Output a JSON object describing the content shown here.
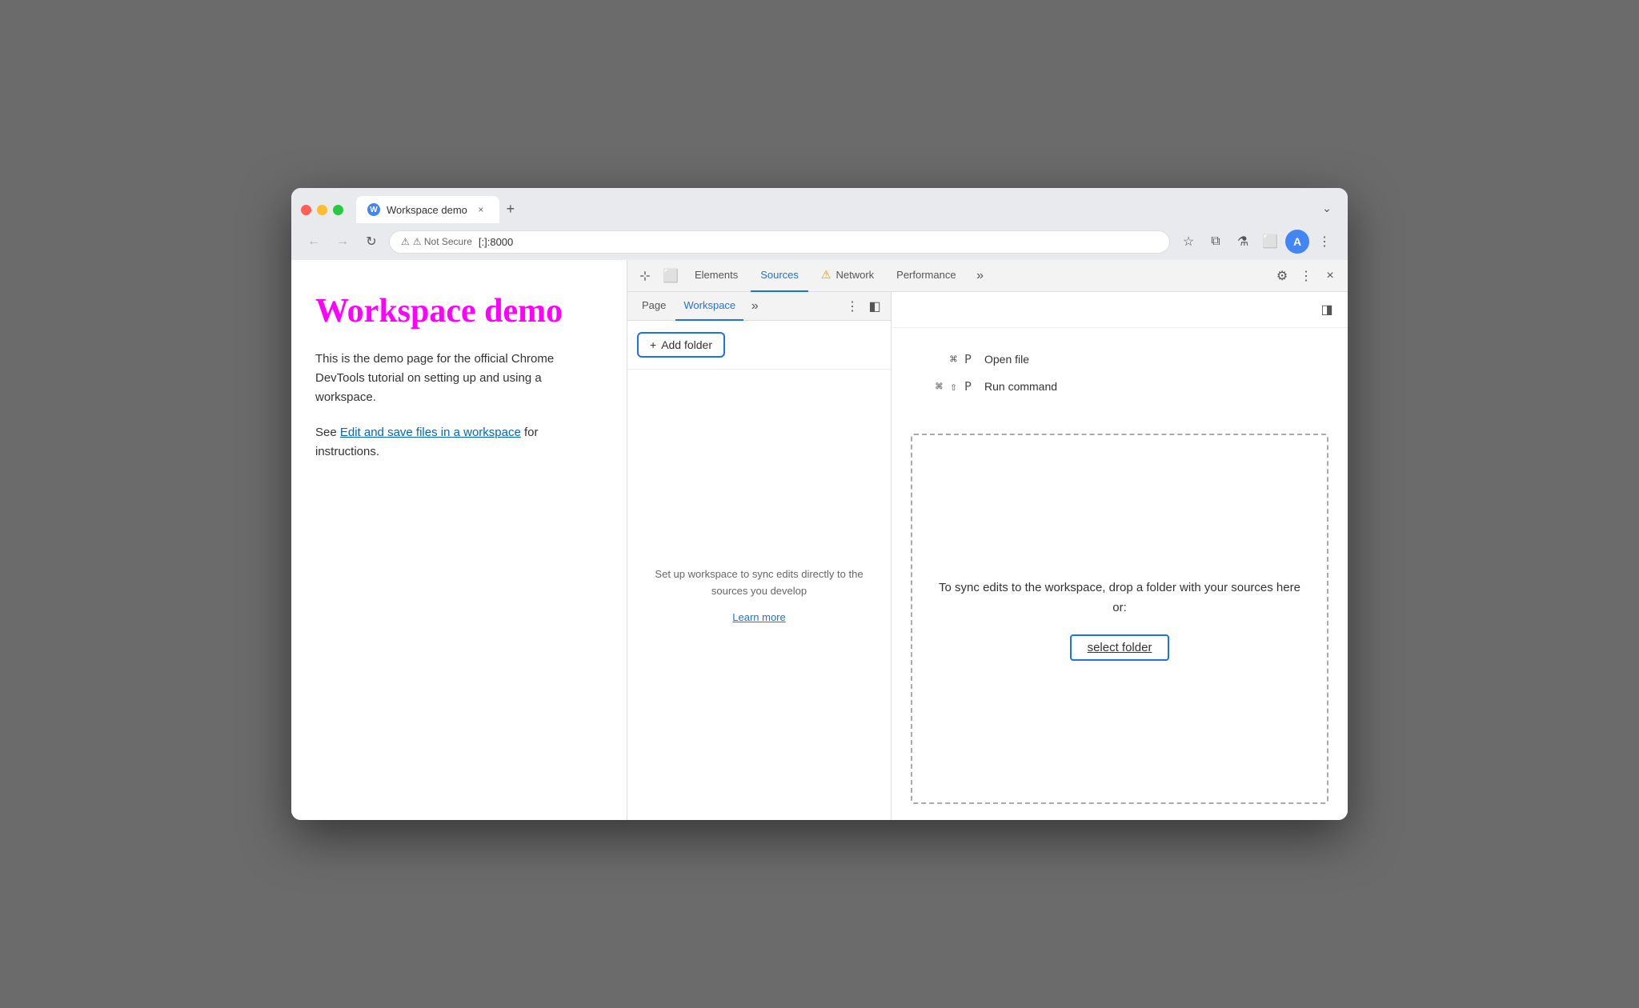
{
  "browser": {
    "tab": {
      "favicon_letter": "W",
      "title": "Workspace demo",
      "close_label": "×"
    },
    "new_tab_label": "+",
    "tab_dropdown_label": "⌄",
    "nav": {
      "back_label": "←",
      "forward_label": "→",
      "reload_label": "↻",
      "security_label": "⚠ Not Secure",
      "url": "[:]:8000"
    },
    "address_actions": {
      "bookmark_label": "☆",
      "extensions_label": "⧉",
      "lab_label": "⚗",
      "split_label": "⬜",
      "profile_label": "A",
      "menu_label": "⋮"
    }
  },
  "page": {
    "title": "Workspace demo",
    "description": "This is the demo page for the official Chrome DevTools tutorial on setting up and using a workspace.",
    "see_label": "See ",
    "link_text": "Edit and save files in a workspace",
    "link_suffix": " for instructions."
  },
  "devtools": {
    "toolbar": {
      "inspect_icon": "⊹",
      "device_icon": "⬜",
      "tabs": [
        {
          "label": "Elements",
          "active": false
        },
        {
          "label": "Sources",
          "active": true
        },
        {
          "label": "Network",
          "active": false,
          "warning": true
        },
        {
          "label": "Performance",
          "active": false
        }
      ],
      "more_label": "»",
      "settings_icon": "⚙",
      "more_options_label": "⋮",
      "close_label": "×"
    },
    "sources": {
      "tabs": [
        {
          "label": "Page",
          "active": false
        },
        {
          "label": "Workspace",
          "active": true
        }
      ],
      "more_label": "»",
      "options_label": "⋮",
      "toggle_sidebar_label": "◧",
      "toggle_right_label": "◨"
    },
    "add_folder": {
      "icon": "+",
      "label": "Add folder"
    },
    "workspace_info": {
      "text": "Set up workspace to sync edits directly to the sources you develop",
      "learn_more_label": "Learn more"
    },
    "file_commands": [
      {
        "shortcut": "⌘ P",
        "action": "Open file"
      },
      {
        "shortcut": "⌘ ⇧ P",
        "action": "Run command"
      }
    ],
    "drop_zone": {
      "text": "To sync edits to the workspace, drop a folder with your sources here or:",
      "select_folder_label": "select folder"
    }
  }
}
